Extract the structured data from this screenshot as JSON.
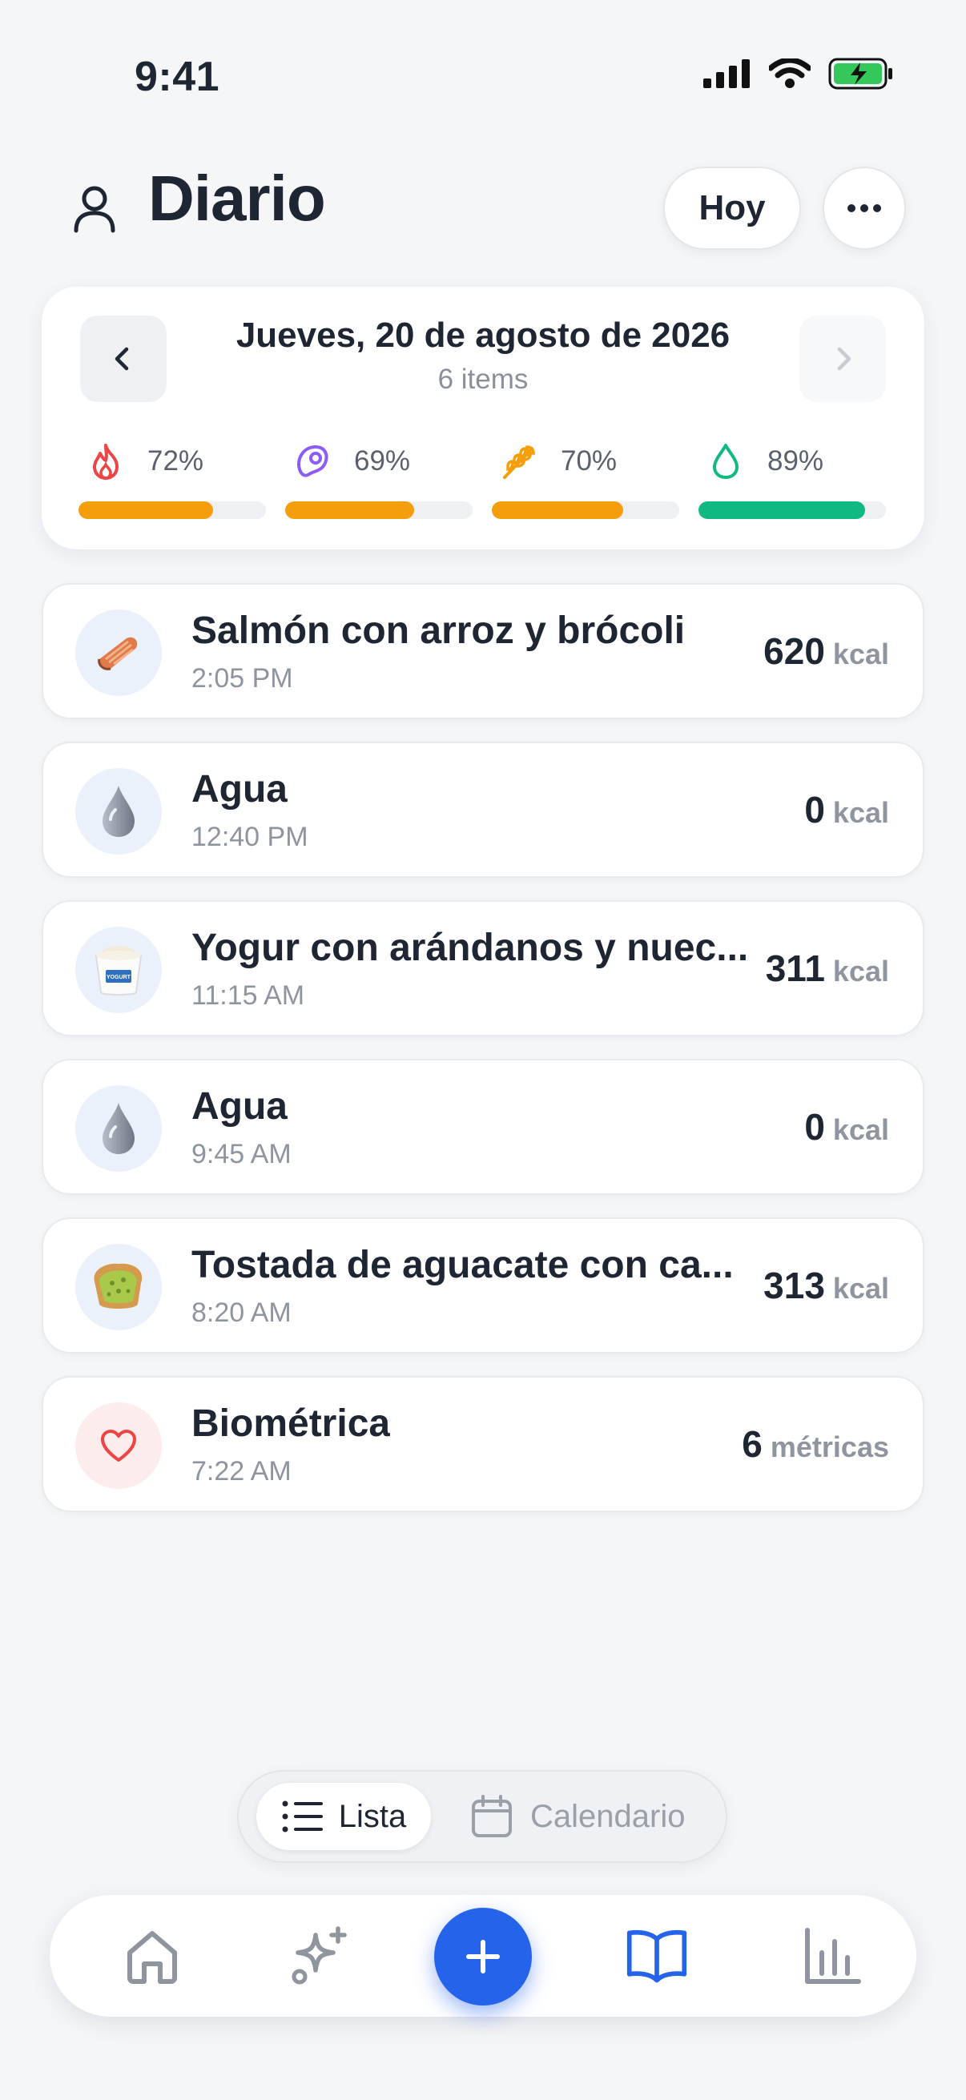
{
  "status_bar": {
    "time": "9:41"
  },
  "header": {
    "title": "Diario",
    "today_label": "Hoy"
  },
  "summary": {
    "date": "Jueves, 20 de agosto de 2026",
    "item_count": "6 items",
    "macros": [
      {
        "name": "calorias",
        "icon": "flame-icon",
        "percent_label": "72%",
        "value": 0.72,
        "color": "#f59e0b",
        "icon_color": "#ef4444"
      },
      {
        "name": "proteina",
        "icon": "steak-icon",
        "percent_label": "69%",
        "value": 0.69,
        "color": "#f59e0b",
        "icon_color": "#8b5cf6"
      },
      {
        "name": "carbohidratos",
        "icon": "wheat-icon",
        "percent_label": "70%",
        "value": 0.7,
        "color": "#f59e0b",
        "icon_color": "#f59e0b"
      },
      {
        "name": "agua",
        "icon": "drop-icon",
        "percent_label": "89%",
        "value": 0.89,
        "color": "#10b981",
        "icon_color": "#10b981"
      }
    ]
  },
  "entries": [
    {
      "name": "Salmón con arroz y brócoli",
      "time": "2:05 PM",
      "value": "620",
      "unit": "kcal",
      "icon": "salmon-icon"
    },
    {
      "name": "Agua",
      "time": "12:40 PM",
      "value": "0",
      "unit": "kcal",
      "icon": "water-drop-icon"
    },
    {
      "name": "Yogur con arándanos y nuec...",
      "time": "11:15 AM",
      "value": "311",
      "unit": "kcal",
      "icon": "yogurt-icon",
      "icon_label": "YOGURT"
    },
    {
      "name": "Agua",
      "time": "9:45 AM",
      "value": "0",
      "unit": "kcal",
      "icon": "water-drop-icon"
    },
    {
      "name": "Tostada de aguacate con ca...",
      "time": "8:20 AM",
      "value": "313",
      "unit": "kcal",
      "icon": "avocado-toast-icon"
    },
    {
      "name": "Biométrica",
      "time": "7:22 AM",
      "value": "6",
      "unit": "métricas",
      "icon": "heart-icon"
    }
  ],
  "view_toggle": {
    "list_label": "Lista",
    "calendar_label": "Calendario"
  },
  "tab_bar": {
    "tabs": [
      "home-icon",
      "sparkle-icon",
      "plus-icon",
      "book-icon",
      "chart-icon"
    ],
    "active": "book-icon",
    "accent": "#2563eb"
  }
}
